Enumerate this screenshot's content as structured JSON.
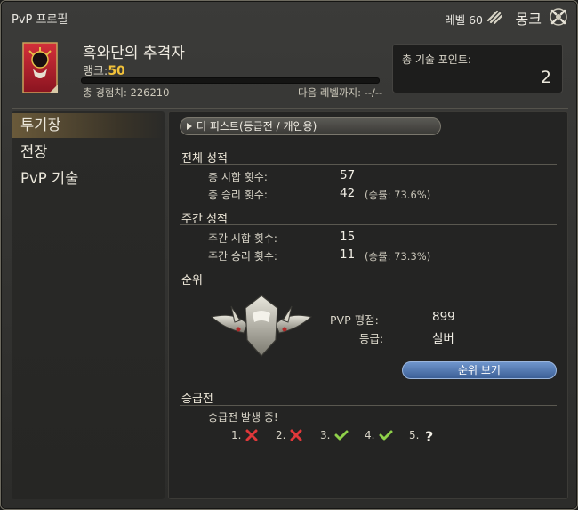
{
  "window": {
    "title": "PvP 프로필",
    "level_label": "레벨 60",
    "job_name": "몽크",
    "job_icon": "monk-job-icon",
    "close_icon": "close-icon"
  },
  "profile": {
    "char_name": "흑와단의 추격자",
    "rank_label": "랭크:",
    "rank_value": "50",
    "xp_total": "총 경험치: 226210",
    "xp_next": "다음 레벨까지: --/--",
    "xp_progress": 0,
    "emblem_icon": "grand-company-emblem-icon"
  },
  "skill_points": {
    "label": "총 기술 포인트:",
    "value": "2"
  },
  "sidebar": {
    "items": [
      {
        "label": "투기장",
        "active": true
      },
      {
        "label": "전장",
        "active": false
      },
      {
        "label": "PvP 기술",
        "active": false
      }
    ]
  },
  "content": {
    "tab_label": "더 피스트(등급전 / 개인용)",
    "overall": {
      "heading": "전체 성적",
      "matches_label": "총 시합 횟수:",
      "matches_value": "57",
      "wins_label": "총 승리 횟수:",
      "wins_value": "42",
      "win_rate": "(승률: 73.6%)"
    },
    "weekly": {
      "heading": "주간 성적",
      "matches_label": "주간 시합 횟수:",
      "matches_value": "15",
      "wins_label": "주간 승리 횟수:",
      "wins_value": "11",
      "win_rate": "(승률: 73.3%)"
    },
    "ranking": {
      "heading": "순위",
      "rating_label": "PVP 평점:",
      "rating_value": "899",
      "tier_label": "등급:",
      "tier_value": "실버",
      "button_label": "순위 보기",
      "crest_icon": "silver-tier-crest-icon"
    },
    "promotion": {
      "heading": "승급전",
      "status": "승급전 발생 중!",
      "matches": [
        {
          "num": "1.",
          "result": "loss"
        },
        {
          "num": "2.",
          "result": "loss"
        },
        {
          "num": "3.",
          "result": "win"
        },
        {
          "num": "4.",
          "result": "win"
        },
        {
          "num": "5.",
          "result": "pending"
        }
      ]
    }
  },
  "colors": {
    "rank_gold": "#f2c23a",
    "win_green": "#8fd14a",
    "loss_red": "#e0383a",
    "button_blue": "#4f76b3"
  }
}
